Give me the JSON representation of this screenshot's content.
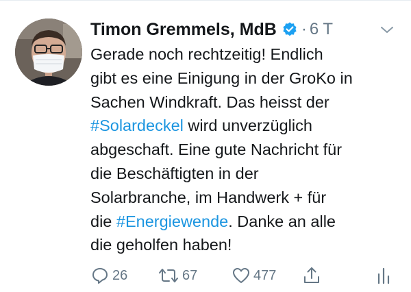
{
  "author": {
    "name": "Timon Gremmels, MdB",
    "verified": true,
    "verified_icon": "verified-badge-icon",
    "timestamp": "6 T",
    "separator": "·"
  },
  "tweet": {
    "lines": [
      {
        "segments": [
          {
            "text": "Gerade noch rechtzeitig! Endlich",
            "type": "text"
          }
        ]
      },
      {
        "segments": [
          {
            "text": "gibt es eine Einigung in der GroKo in",
            "type": "text"
          }
        ]
      },
      {
        "segments": [
          {
            "text": "Sachen Windkraft. Das heisst der",
            "type": "text"
          }
        ]
      },
      {
        "segments": [
          {
            "text": "#Solardeckel",
            "type": "hashtag"
          },
          {
            "text": " wird unverzüglich",
            "type": "text"
          }
        ]
      },
      {
        "segments": [
          {
            "text": "abgeschaft. Eine gute Nachricht für",
            "type": "text"
          }
        ]
      },
      {
        "segments": [
          {
            "text": "die Beschäftigten in der",
            "type": "text"
          }
        ]
      },
      {
        "segments": [
          {
            "text": "Solarbranche, im Handwerk + für",
            "type": "text"
          }
        ]
      },
      {
        "segments": [
          {
            "text": "die ",
            "type": "text"
          },
          {
            "text": "#Energiewende",
            "type": "hashtag"
          },
          {
            "text": ". Danke an alle",
            "type": "text"
          }
        ]
      },
      {
        "segments": [
          {
            "text": "die geholfen haben!",
            "type": "text"
          }
        ]
      }
    ]
  },
  "actions": {
    "reply": {
      "icon": "reply-icon",
      "count": "26"
    },
    "retweet": {
      "icon": "retweet-icon",
      "count": "67"
    },
    "like": {
      "icon": "heart-icon",
      "count": "477"
    },
    "share": {
      "icon": "share-icon"
    },
    "analytics": {
      "icon": "analytics-icon"
    }
  },
  "colors": {
    "text": "#14171a",
    "secondary": "#657786",
    "link": "#1b95e0",
    "verified": "#1da1f2"
  }
}
